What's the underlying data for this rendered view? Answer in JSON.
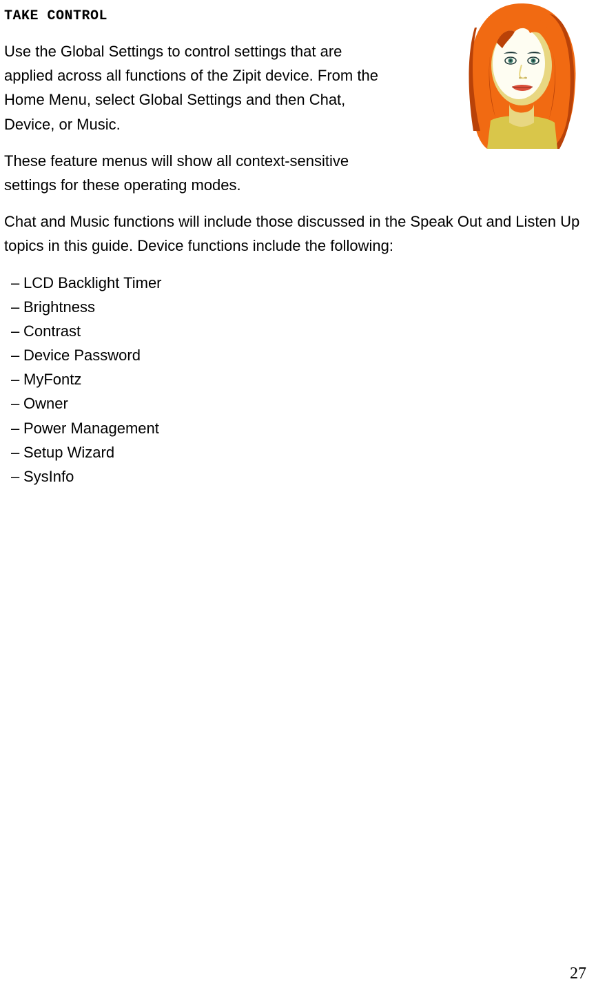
{
  "heading": "TAKE CONTROL",
  "paragraphs": {
    "p1": "Use the Global Settings to control settings that are applied across all functions of the Zipit device.   From the Home Menu, select Global Settings and then Chat, Device, or Music.",
    "p2": "These feature menus will show all context-sensitive settings for these operating modes.",
    "p3": "Chat and Music functions will include those discussed in the Speak Out and Listen Up topics in this guide. Device functions include the following:"
  },
  "list_items": [
    "LCD Backlight Timer",
    "Brightness",
    "Contrast",
    "Device Password",
    "MyFontz",
    "Owner",
    "Power Management",
    "Setup Wizard",
    "SysInfo"
  ],
  "page_number": "27",
  "illustration": {
    "name": "woman-portrait-illustration",
    "colors": {
      "hair": "#f16a12",
      "hair_dark": "#b94208",
      "skin_shadow": "#e8d782",
      "skin_light": "#fefdf2",
      "features": "#1f3a3a",
      "eye": "#3a7e6f",
      "lips": "#d94f3a",
      "shirt": "#d9c64a"
    }
  }
}
